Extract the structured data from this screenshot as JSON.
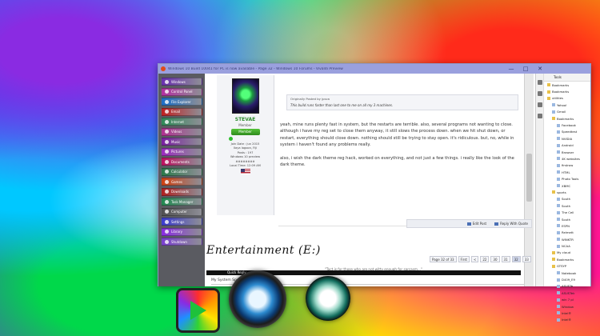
{
  "window": {
    "title": "Windows 10 Build 10041 for PC is now available - Page 32 - Windows 10 Forums - Vivaldi Preview",
    "controls": [
      "—",
      "□",
      "✕"
    ]
  },
  "nav": {
    "buttons": [
      {
        "label": "Windows",
        "color": "#6a2fb0"
      },
      {
        "label": "Control Panel",
        "color": "#b32fa0"
      },
      {
        "label": "File Explorer",
        "color": "#1a6fc8"
      },
      {
        "label": "Email",
        "color": "#c02020"
      },
      {
        "label": "Internet",
        "color": "#2e8b57"
      },
      {
        "label": "Videos",
        "color": "#b03090"
      },
      {
        "label": "Music",
        "color": "#7a1fa2"
      },
      {
        "label": "Pictures",
        "color": "#9a2bbf"
      },
      {
        "label": "Documents",
        "color": "#c01060"
      },
      {
        "label": "Calculator",
        "color": "#2a7a4a"
      },
      {
        "label": "Games",
        "color": "#d04010"
      },
      {
        "label": "Downloads",
        "color": "#b02020"
      },
      {
        "label": "Task Manager",
        "color": "#208a50"
      },
      {
        "label": "Computer",
        "color": "#505050"
      },
      {
        "label": "Settings",
        "color": "#3b3bd0"
      },
      {
        "label": "Library",
        "color": "#8a2be2"
      },
      {
        "label": "Shutdown",
        "color": "#7a3fd0"
      }
    ]
  },
  "post": {
    "user": {
      "name": "STEVAE",
      "role": "Member",
      "badge": "Member",
      "join_date": "Join Date : Jun 2015",
      "location": "Ilaya lagoon, Fiji",
      "posts": "Posts : 197",
      "os": "Windows 10 preview",
      "os_code": "########",
      "local_time": "Local Time: 12:09 AM"
    },
    "quote_origin": "Originally Posted by jpsca",
    "quote_text": "This build runs faster than last one to me on all my 3 machines.",
    "p1": "yeah, mine runs plenty fast in system, but the restarts are terrible. also, several programs not wanting to close. although i have my reg set to close them anyway, it still slows the process down. when we hit shut down, or restart, everything should close down. nothing should still be trying to stay open. it's ridiculous. but, no, while in system i haven't found any problems really.",
    "p2": "also, i wish the dark theme reg hack, worked on everything, and not just a few things. i really like the look of the dark theme.",
    "signature": "\"Tact is for those who are not witty enough for sarcasm...\"",
    "specs": "My System Specs",
    "actions": {
      "edit": "Edit Post",
      "reply": "Reply With Quote"
    },
    "banner": "Entertainment (E:)",
    "pager": [
      "Page 32 of 33",
      "First",
      "<",
      "22",
      "30",
      "31",
      "32",
      "33"
    ],
    "quick_reply": "Quick Reply"
  },
  "bookmarks": {
    "toolbar": "Tools",
    "items": [
      {
        "label": "Bookmarks",
        "kind": "folder",
        "depth": 1
      },
      {
        "label": "Bookmarks",
        "kind": "folder",
        "depth": 1
      },
      {
        "label": "utilities",
        "kind": "folder",
        "depth": 1
      },
      {
        "label": "Yahoo!",
        "kind": "page",
        "depth": 2
      },
      {
        "label": "Gmail",
        "kind": "page",
        "depth": 2
      },
      {
        "label": "Bookmarks",
        "kind": "folder",
        "depth": 2
      },
      {
        "label": "Facebook",
        "kind": "page",
        "depth": 3
      },
      {
        "label": "Speedtest",
        "kind": "page",
        "depth": 3
      },
      {
        "label": "NVIDIA",
        "kind": "page",
        "depth": 3
      },
      {
        "label": "Android",
        "kind": "page",
        "depth": 3
      },
      {
        "label": "Browser",
        "kind": "page",
        "depth": 3
      },
      {
        "label": "4K websites",
        "kind": "page",
        "depth": 3
      },
      {
        "label": "firstrow",
        "kind": "page",
        "depth": 3
      },
      {
        "label": "HTML",
        "kind": "page",
        "depth": 3
      },
      {
        "label": "Photo Tools",
        "kind": "page",
        "depth": 3
      },
      {
        "label": "XBMC",
        "kind": "page",
        "depth": 3
      },
      {
        "label": "sports",
        "kind": "folder",
        "depth": 2
      },
      {
        "label": "South",
        "kind": "page",
        "depth": 3
      },
      {
        "label": "South",
        "kind": "page",
        "depth": 3
      },
      {
        "label": "The Cell",
        "kind": "page",
        "depth": 3
      },
      {
        "label": "South",
        "kind": "page",
        "depth": 3
      },
      {
        "label": "ESPN",
        "kind": "page",
        "depth": 3
      },
      {
        "label": "Relmett",
        "kind": "page",
        "depth": 3
      },
      {
        "label": "WINKTR",
        "kind": "page",
        "depth": 3
      },
      {
        "label": "NCAA",
        "kind": "page",
        "depth": 3
      },
      {
        "label": "My cloud",
        "kind": "folder",
        "depth": 2
      },
      {
        "label": "Bookmarks",
        "kind": "folder",
        "depth": 2
      },
      {
        "label": "GTSYP",
        "kind": "folder",
        "depth": 2
      },
      {
        "label": "Notebook",
        "kind": "page",
        "depth": 3
      },
      {
        "label": "D409_E9",
        "kind": "page",
        "depth": 3
      },
      {
        "label": "ASUSTe",
        "kind": "page",
        "depth": 3
      },
      {
        "label": "ASUSTek",
        "kind": "page",
        "depth": 3
      },
      {
        "label": "win 7 pl",
        "kind": "page",
        "depth": 3
      },
      {
        "label": "Window",
        "kind": "page",
        "depth": 3
      },
      {
        "label": "Intel®",
        "kind": "page",
        "depth": 3
      },
      {
        "label": "Intel®",
        "kind": "page",
        "depth": 3
      }
    ]
  },
  "colors": {
    "titlebar": "#9aa0de",
    "username": "#2e8b2e",
    "nav_bg": "#5a5b61"
  }
}
